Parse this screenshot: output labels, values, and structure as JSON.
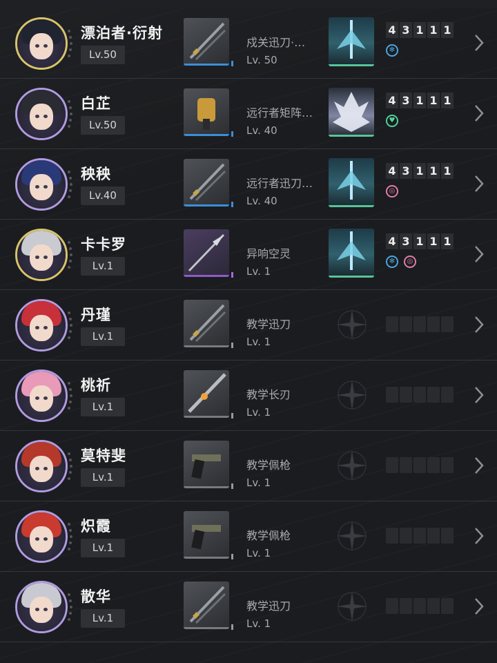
{
  "characters": [
    {
      "name": "漂泊者·衍射",
      "level": "Lv.50",
      "ring": "gold",
      "hair": "#1f2430",
      "weapon": {
        "name": "戍关迅刀·…",
        "level": "Lv. 50",
        "rarity": "blue",
        "kind": "blade"
      },
      "echo": {
        "present": true,
        "style": "crystal",
        "nums": [
          "4",
          "3",
          "1",
          "1",
          "1"
        ],
        "sonata": [
          {
            "color": "#4aa6e2",
            "glyph": "✻"
          }
        ]
      }
    },
    {
      "name": "白芷",
      "level": "Lv.50",
      "ring": "purple",
      "hair": "#2b2b33",
      "weapon": {
        "name": "远行者矩阵…",
        "level": "Lv. 40",
        "rarity": "blue",
        "kind": "rectifier"
      },
      "echo": {
        "present": true,
        "style": "white",
        "nums": [
          "4",
          "3",
          "1",
          "1",
          "1"
        ],
        "sonata": [
          {
            "color": "#4fd39a",
            "glyph": "♥"
          }
        ]
      }
    },
    {
      "name": "秧秧",
      "level": "Lv.40",
      "ring": "purple",
      "hair": "#2a3a78",
      "weapon": {
        "name": "远行者迅刀…",
        "level": "Lv. 40",
        "rarity": "blue",
        "kind": "blade"
      },
      "echo": {
        "present": true,
        "style": "crystal",
        "nums": [
          "4",
          "3",
          "1",
          "1",
          "1"
        ],
        "sonata": [
          {
            "color": "#e07ea9",
            "glyph": "◎"
          }
        ]
      }
    },
    {
      "name": "卡卡罗",
      "level": "Lv.1",
      "ring": "gold",
      "hair": "#c9cbd1",
      "weapon": {
        "name": "异响空灵",
        "level": "Lv. 1",
        "rarity": "purple",
        "kind": "spear"
      },
      "echo": {
        "present": true,
        "style": "crystal",
        "nums": [
          "4",
          "3",
          "1",
          "1",
          "1"
        ],
        "sonata": [
          {
            "color": "#4aa6e2",
            "glyph": "✻"
          },
          {
            "color": "#e07ea9",
            "glyph": "◎"
          }
        ]
      }
    },
    {
      "name": "丹瑾",
      "level": "Lv.1",
      "ring": "purple",
      "hair": "#c8303a",
      "weapon": {
        "name": "教学迅刀",
        "level": "Lv. 1",
        "rarity": "grey",
        "kind": "blade"
      },
      "echo": {
        "present": false
      }
    },
    {
      "name": "桃祈",
      "level": "Lv.1",
      "ring": "purple",
      "hair": "#e89ab8",
      "weapon": {
        "name": "教学长刃",
        "level": "Lv. 1",
        "rarity": "grey",
        "kind": "longblade"
      },
      "echo": {
        "present": false
      }
    },
    {
      "name": "莫特斐",
      "level": "Lv.1",
      "ring": "purple",
      "hair": "#b5392b",
      "weapon": {
        "name": "教学佩枪",
        "level": "Lv. 1",
        "rarity": "grey",
        "kind": "pistol"
      },
      "echo": {
        "present": false
      }
    },
    {
      "name": "炽霞",
      "level": "Lv.1",
      "ring": "purple",
      "hair": "#c93a2f",
      "weapon": {
        "name": "教学佩枪",
        "level": "Lv. 1",
        "rarity": "grey",
        "kind": "pistol"
      },
      "echo": {
        "present": false
      }
    },
    {
      "name": "散华",
      "level": "Lv.1",
      "ring": "purple",
      "hair": "#c9c9d2",
      "weapon": {
        "name": "教学迅刀",
        "level": "Lv. 1",
        "rarity": "grey",
        "kind": "blade"
      },
      "echo": {
        "present": false
      }
    }
  ],
  "icons": {
    "chevron": "chevron-right-icon",
    "empty_echo": "sparkle-icon"
  }
}
